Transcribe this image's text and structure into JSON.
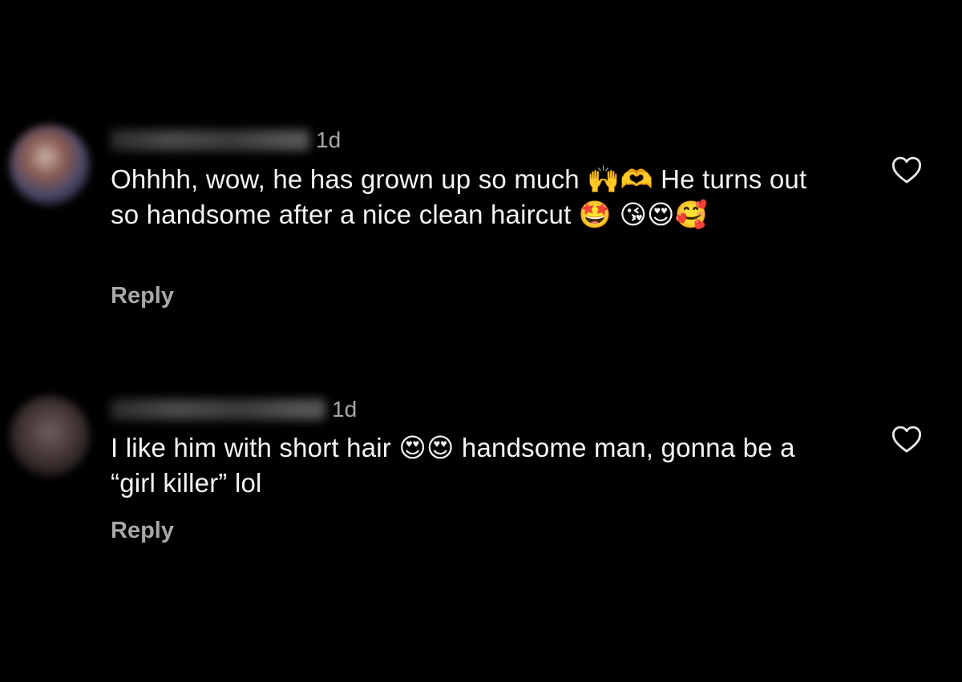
{
  "comments": [
    {
      "username": "u_blurred",
      "time": "1d",
      "text": "Ohhhh, wow, he has grown up so much 🙌🫶 He turns out so handsome after a nice clean haircut 🤩 😘😍🥰",
      "reply_label": "Reply",
      "like_icon": "heart-outline-icon"
    },
    {
      "username": "c_blurred",
      "time": "1d",
      "text": "I like him with short hair 😍😍 handsome man, gonna be a “girl killer” lol",
      "reply_label": "Reply",
      "like_icon": "heart-outline-icon"
    }
  ],
  "colors": {
    "background": "#000000",
    "text": "#f5f5f5",
    "muted": "#a8a8a8"
  }
}
